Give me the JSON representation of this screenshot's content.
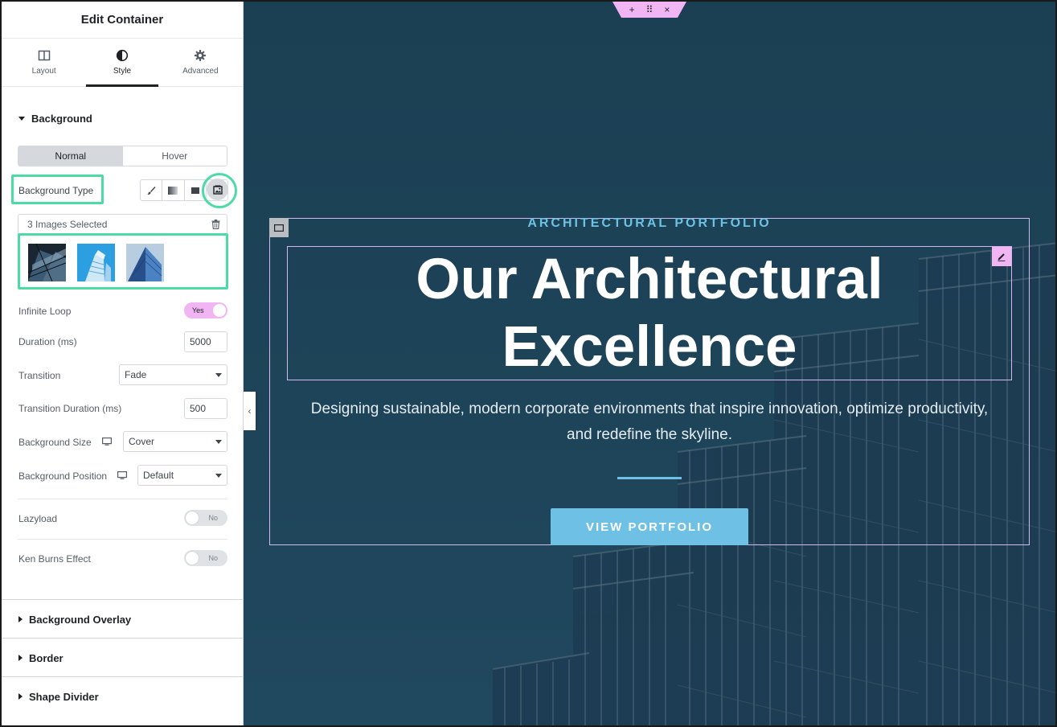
{
  "panel": {
    "title": "Edit Container",
    "tabs": [
      {
        "label": "Layout",
        "icon": "columns-icon"
      },
      {
        "label": "Style",
        "icon": "contrast-icon"
      },
      {
        "label": "Advanced",
        "icon": "gear-icon"
      }
    ],
    "active_tab": "Style"
  },
  "background": {
    "section_label": "Background",
    "state_normal": "Normal",
    "state_hover": "Hover",
    "type_label": "Background Type",
    "type_options": [
      "brush-icon",
      "gradient-icon",
      "video-icon",
      "slideshow-icon"
    ],
    "selected_type": "slideshow-icon",
    "gallery_label": "3 Images Selected",
    "infinite_loop_label": "Infinite Loop",
    "infinite_loop_value": "Yes",
    "duration_label": "Duration (ms)",
    "duration_value": "5000",
    "transition_label": "Transition",
    "transition_value": "Fade",
    "transition_duration_label": "Transition Duration (ms)",
    "transition_duration_value": "500",
    "size_label": "Background Size",
    "size_value": "Cover",
    "position_label": "Background Position",
    "position_value": "Default",
    "lazyload_label": "Lazyload",
    "lazyload_value": "No",
    "ken_burns_label": "Ken Burns Effect",
    "ken_burns_value": "No"
  },
  "collapsed_sections": [
    {
      "label": "Background Overlay"
    },
    {
      "label": "Border"
    },
    {
      "label": "Shape Divider"
    }
  ],
  "canvas": {
    "top_handle": {
      "add": "+",
      "move": "⠿",
      "close": "×"
    },
    "eyebrow": "ARCHITECTURAL PORTFOLIO",
    "heading_line1": "Our Architectural",
    "heading_line2": "Excellence",
    "description_line1": "Designing sustainable, modern corporate environments that inspire innovation, optimize productivity,",
    "description_line2": "and redefine the skyline.",
    "cta": "VIEW PORTFOLIO"
  },
  "colors": {
    "accent": "#6ec1e4",
    "highlight": "#4ddba5",
    "editor_pink": "#f1b5f4",
    "canvas_bg": "#1c4257"
  }
}
